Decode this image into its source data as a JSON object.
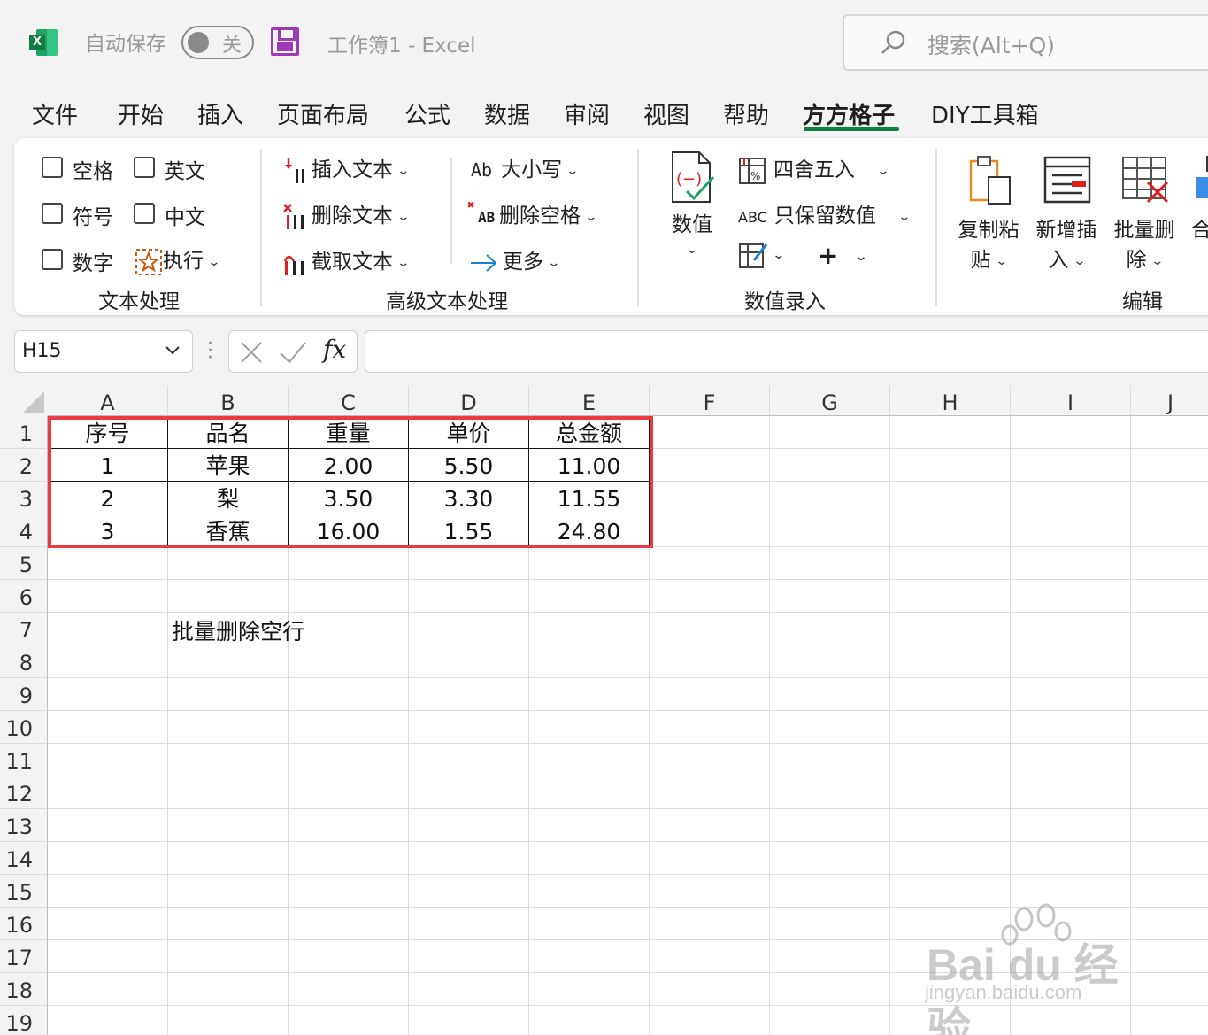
{
  "titlebar": {
    "autosave_label": "自动保存",
    "autosave_state": "关",
    "doc_title": "工作簿1  -  Excel",
    "search_placeholder": "搜索(Alt+Q)"
  },
  "tabs": [
    {
      "label": "文件"
    },
    {
      "label": "开始"
    },
    {
      "label": "插入"
    },
    {
      "label": "页面布局"
    },
    {
      "label": "公式"
    },
    {
      "label": "数据"
    },
    {
      "label": "审阅"
    },
    {
      "label": "视图"
    },
    {
      "label": "帮助"
    },
    {
      "label": "方方格子",
      "active": true
    },
    {
      "label": "DIY工具箱"
    }
  ],
  "ribbon": {
    "text_group": {
      "checkboxes": [
        "空格",
        "英文",
        "符号",
        "中文",
        "数字"
      ],
      "execute": "执行",
      "label": "文本处理"
    },
    "adv_text_group": {
      "insert_text": "插入文本",
      "delete_text": "删除文本",
      "extract_text": "截取文本",
      "case": "大小写",
      "case_icon_text": "Ab",
      "delete_space": "删除空格",
      "delete_space_icon_text": "AB",
      "more": "更多",
      "label": "高级文本处理"
    },
    "number_group": {
      "numeric": "数值",
      "round": "四舍五入",
      "keep_number": "只保留数值",
      "keep_number_icon_text": "ABC",
      "label": "数值录入"
    },
    "edit_group": {
      "copy_paste_1": "复制粘",
      "copy_paste_2": "贴",
      "add_insert_1": "新增插",
      "add_insert_2": "入",
      "batch_delete_1": "批量删",
      "batch_delete_2": "除",
      "merge": "合",
      "label": "编辑"
    }
  },
  "formula_bar": {
    "name_box": "H15",
    "formula": ""
  },
  "sheet": {
    "columns": [
      "A",
      "B",
      "C",
      "D",
      "E",
      "F",
      "G",
      "H",
      "I",
      "J"
    ],
    "rows": [
      "1",
      "2",
      "3",
      "4",
      "5",
      "6",
      "7",
      "8",
      "9",
      "10",
      "11",
      "12",
      "13",
      "14",
      "15",
      "16",
      "17",
      "18",
      "19"
    ],
    "table": [
      [
        "序号",
        "品名",
        "重量",
        "单价",
        "总金额"
      ],
      [
        "1",
        "苹果",
        "2.00",
        "5.50",
        "11.00"
      ],
      [
        "2",
        "梨",
        "3.50",
        "3.30",
        "11.55"
      ],
      [
        "3",
        "香蕉",
        "16.00",
        "1.55",
        "24.80"
      ]
    ],
    "note_b7": "批量删除空行"
  },
  "watermark": {
    "brand": "Bai du 经验",
    "url": "jingyan.baidu.com"
  },
  "colors": {
    "excel_green": "#107c41",
    "highlight_red": "#ea3b44",
    "save_purple": "#9c3bb5"
  }
}
